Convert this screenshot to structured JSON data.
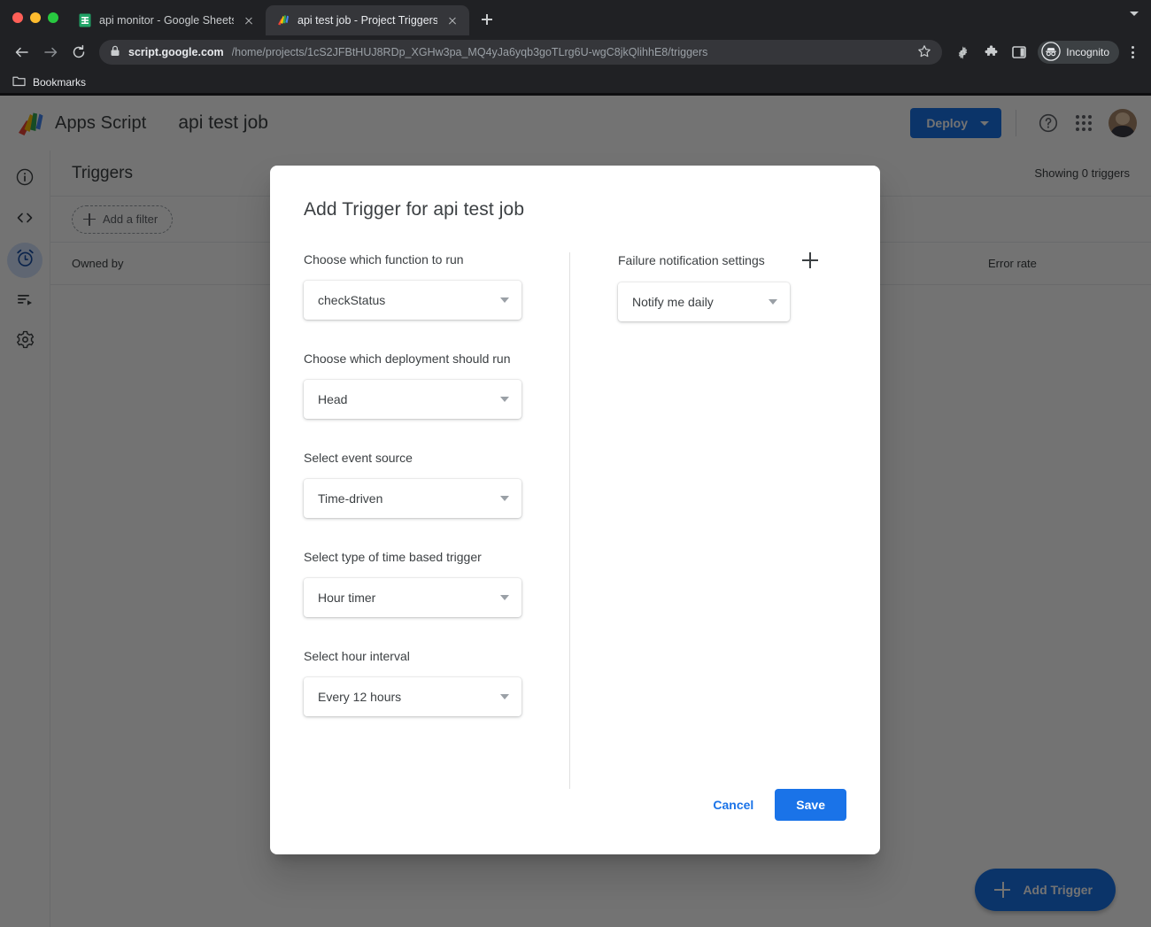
{
  "browser": {
    "tabs": [
      {
        "title": "api monitor - Google Sheets",
        "favicon": "google-sheets-icon",
        "active": false
      },
      {
        "title": "api test job - Project Triggers -",
        "favicon": "apps-script-icon",
        "active": true
      }
    ],
    "new_tab_label": "New Tab",
    "url_domain": "script.google.com",
    "url_path": "/home/projects/1cS2JFBtHUJ8RDp_XGHw3pa_MQ4yJa6yqb3goTLrg6U-wgC8jkQlihhE8/triggers",
    "profile_label": "Incognito",
    "bookmarks_label": "Bookmarks",
    "toolbar_icons": [
      "back-icon",
      "forward-icon",
      "reload-icon",
      "lock-icon",
      "star-icon",
      "gear-icon",
      "extensions-icon",
      "side-panel-icon",
      "kebab-menu-icon"
    ]
  },
  "header": {
    "product_name": "Apps Script",
    "project_name": "api test job",
    "deploy_label": "Deploy",
    "help_label": "Help",
    "apps_label": "Google apps",
    "account_label": "Google Account"
  },
  "rail": {
    "items": [
      {
        "name": "overview",
        "icon": "info-icon",
        "active": false
      },
      {
        "name": "editor",
        "icon": "code-brackets-icon",
        "active": false
      },
      {
        "name": "triggers",
        "icon": "alarm-clock-icon",
        "active": true
      },
      {
        "name": "executions",
        "icon": "executions-icon",
        "active": false
      },
      {
        "name": "project-settings",
        "icon": "gear-icon",
        "active": false
      }
    ]
  },
  "main": {
    "title": "Triggers",
    "showing": "Showing 0 triggers",
    "filter_label": "Add a filter",
    "columns": [
      "Owned by",
      "Error rate"
    ],
    "fab_label": "Add Trigger"
  },
  "dialog": {
    "title": "Add Trigger for api test job",
    "fields": [
      {
        "label": "Choose which function to run",
        "value": "checkStatus",
        "name": "function-select"
      },
      {
        "label": "Choose which deployment should run",
        "value": "Head",
        "name": "deployment-select"
      },
      {
        "label": "Select event source",
        "value": "Time-driven",
        "name": "event-source-select"
      },
      {
        "label": "Select type of time based trigger",
        "value": "Hour timer",
        "name": "time-trigger-type-select"
      },
      {
        "label": "Select hour interval",
        "value": "Every 12 hours",
        "name": "hour-interval-select"
      }
    ],
    "notification": {
      "label": "Failure notification settings",
      "value": "Notify me daily",
      "add_label": "Add notification"
    },
    "cancel_label": "Cancel",
    "save_label": "Save"
  },
  "colors": {
    "accent_blue": "#1a73e8",
    "rail_active_bg": "#d2e3fc",
    "chrome_bg": "#202124",
    "text_primary": "#3c4043"
  }
}
